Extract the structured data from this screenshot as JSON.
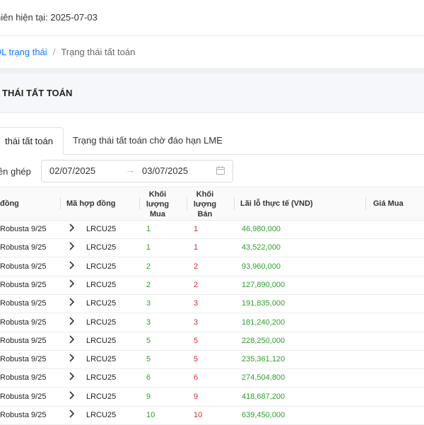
{
  "header": {
    "session_text": "hiên hiện tại: 2025-07-03"
  },
  "breadcrumb": {
    "link": "QL trạng thái",
    "separator": "/",
    "current": "Trạng thái tất toán"
  },
  "panel": {
    "title": "THÁI TẤT TOÁN"
  },
  "tabs": [
    {
      "label": "thái tất toán",
      "active": true
    },
    {
      "label": "Trạng thái tất toán chờ đáo hạn LME",
      "active": false
    }
  ],
  "filter": {
    "label": "iên ghép",
    "date_start": "02/07/2025",
    "arrow": "→",
    "date_end": "03/07/2025",
    "icon": "calendar-icon"
  },
  "table": {
    "headers": {
      "contract": "đồng",
      "code": "Mã hợp đồng",
      "buy_qty_1": "Khối",
      "buy_qty_2": "lượng",
      "buy_qty_3": "Mua",
      "sell_qty_1": "Khối",
      "sell_qty_2": "lượng",
      "sell_qty_3": "Bán",
      "pnl": "Lãi lỗ thực tế (VND)",
      "buy_price": "Giá Mua"
    },
    "rows": [
      {
        "name": "Robusta 9/25",
        "code": "LRCU25",
        "buy": "1",
        "sell": "1",
        "pnl": "46,980,000"
      },
      {
        "name": "Robusta 9/25",
        "code": "LRCU25",
        "buy": "1",
        "sell": "1",
        "pnl": "43,522,000"
      },
      {
        "name": "Robusta 9/25",
        "code": "LRCU25",
        "buy": "2",
        "sell": "2",
        "pnl": "93,960,000"
      },
      {
        "name": "Robusta 9/25",
        "code": "LRCU25",
        "buy": "2",
        "sell": "2",
        "pnl": "127,890,000"
      },
      {
        "name": "Robusta 9/25",
        "code": "LRCU25",
        "buy": "3",
        "sell": "3",
        "pnl": "191,835,000"
      },
      {
        "name": "Robusta 9/25",
        "code": "LRCU25",
        "buy": "3",
        "sell": "3",
        "pnl": "181,240,200"
      },
      {
        "name": "Robusta 9/25",
        "code": "LRCU25",
        "buy": "5",
        "sell": "5",
        "pnl": "228,250,000"
      },
      {
        "name": "Robusta 9/25",
        "code": "LRCU25",
        "buy": "5",
        "sell": "5",
        "pnl": "235,361,120"
      },
      {
        "name": "Robusta 9/25",
        "code": "LRCU25",
        "buy": "6",
        "sell": "6",
        "pnl": "274,504,800"
      },
      {
        "name": "Robusta 9/25",
        "code": "LRCU25",
        "buy": "9",
        "sell": "9",
        "pnl": "418,687,200"
      },
      {
        "name": "Robusta 9/25",
        "code": "LRCU25",
        "buy": "10",
        "sell": "10",
        "pnl": "639,450,000"
      }
    ]
  },
  "colors": {
    "accent": "#1677ff",
    "positive": "#2ea02e",
    "negative": "#d32f2f"
  }
}
